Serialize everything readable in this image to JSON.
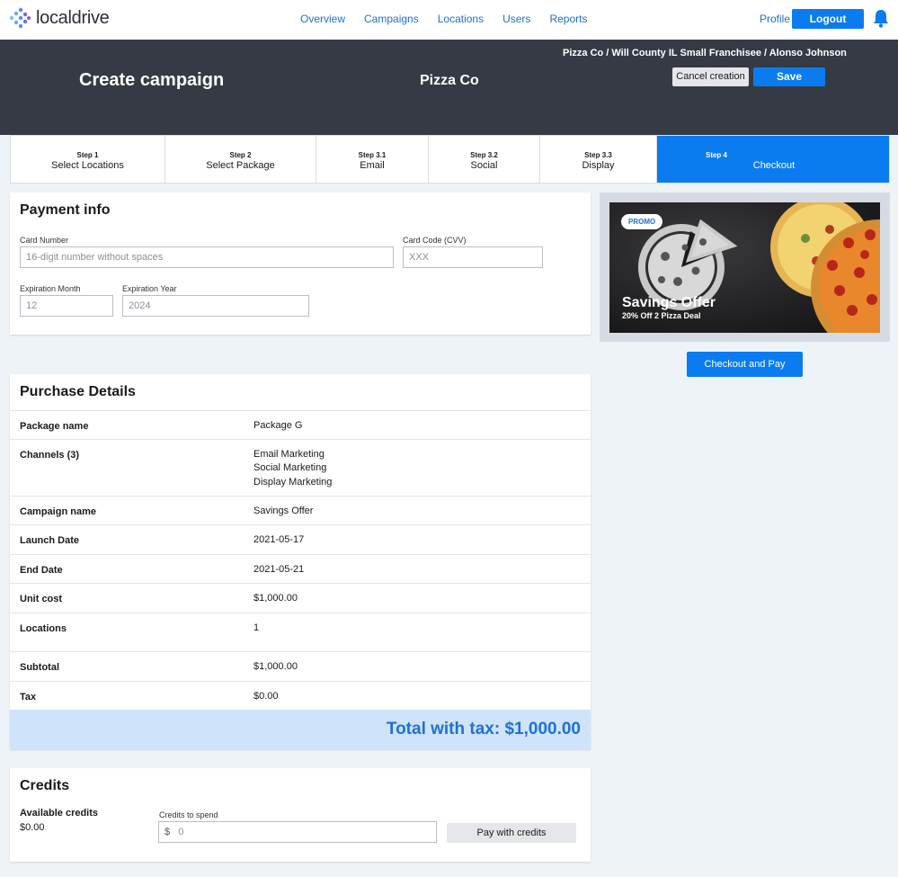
{
  "nav": {
    "logo_text": "localdrive",
    "links": [
      "Overview",
      "Campaigns",
      "Locations",
      "Users",
      "Reports"
    ],
    "profile": "Profile",
    "logout": "Logout"
  },
  "header": {
    "title": "Create campaign",
    "company": "Pizza Co",
    "breadcrumb": "Pizza Co / Will County IL Small Franchisee / Alonso Johnson",
    "cancel": "Cancel creation",
    "save": "Save"
  },
  "steps": [
    {
      "num": "Step 1",
      "label": "Select Locations"
    },
    {
      "num": "Step 2",
      "label": "Select Package"
    },
    {
      "num": "Step 3.1",
      "label": "Email"
    },
    {
      "num": "Step 3.2",
      "label": "Social"
    },
    {
      "num": "Step 3.3",
      "label": "Display"
    },
    {
      "num": "Step 4",
      "label": "Checkout"
    }
  ],
  "payment": {
    "title": "Payment info",
    "card_number_label": "Card Number",
    "card_number_placeholder": "16-digit number without spaces",
    "cvv_label": "Card Code (CVV)",
    "cvv_placeholder": "XXX",
    "exp_month_label": "Expiration Month",
    "exp_month_value": "12",
    "exp_year_label": "Expiration Year",
    "exp_year_value": "2024"
  },
  "purchase": {
    "title": "Purchase Details",
    "rows": [
      {
        "key": "Package name",
        "value": "Package G"
      },
      {
        "key": "Channels (3)",
        "value": "Email Marketing",
        "value2": "Social Marketing",
        "value3": "Display Marketing"
      },
      {
        "key": "Campaign name",
        "value": "Savings Offer"
      },
      {
        "key": "Launch Date",
        "value": "2021-05-17"
      },
      {
        "key": "End Date",
        "value": "2021-05-21"
      },
      {
        "key": "Unit cost",
        "value": "$1,000.00"
      },
      {
        "key": "Locations",
        "value": "1"
      },
      {
        "key": "Subtotal",
        "value": "$1,000.00"
      },
      {
        "key": "Tax",
        "value": "$0.00"
      }
    ],
    "total": "Total with tax: $1,000.00"
  },
  "promo": {
    "badge": "PROMO",
    "title": "Savings Offer",
    "subtitle": "20% Off 2 Pizza Deal"
  },
  "checkout_button": "Checkout and Pay",
  "credits": {
    "title": "Credits",
    "available_label": "Available credits",
    "available_value": "$0.00",
    "spend_label": "Credits to spend",
    "currency": "$",
    "spend_value": "0",
    "pay_button": "Pay with credits"
  },
  "colors": {
    "primary": "#0a7cf0",
    "header_bg": "#363a44",
    "total_bg": "#cfe3fb",
    "total_text": "#1d72d6"
  }
}
